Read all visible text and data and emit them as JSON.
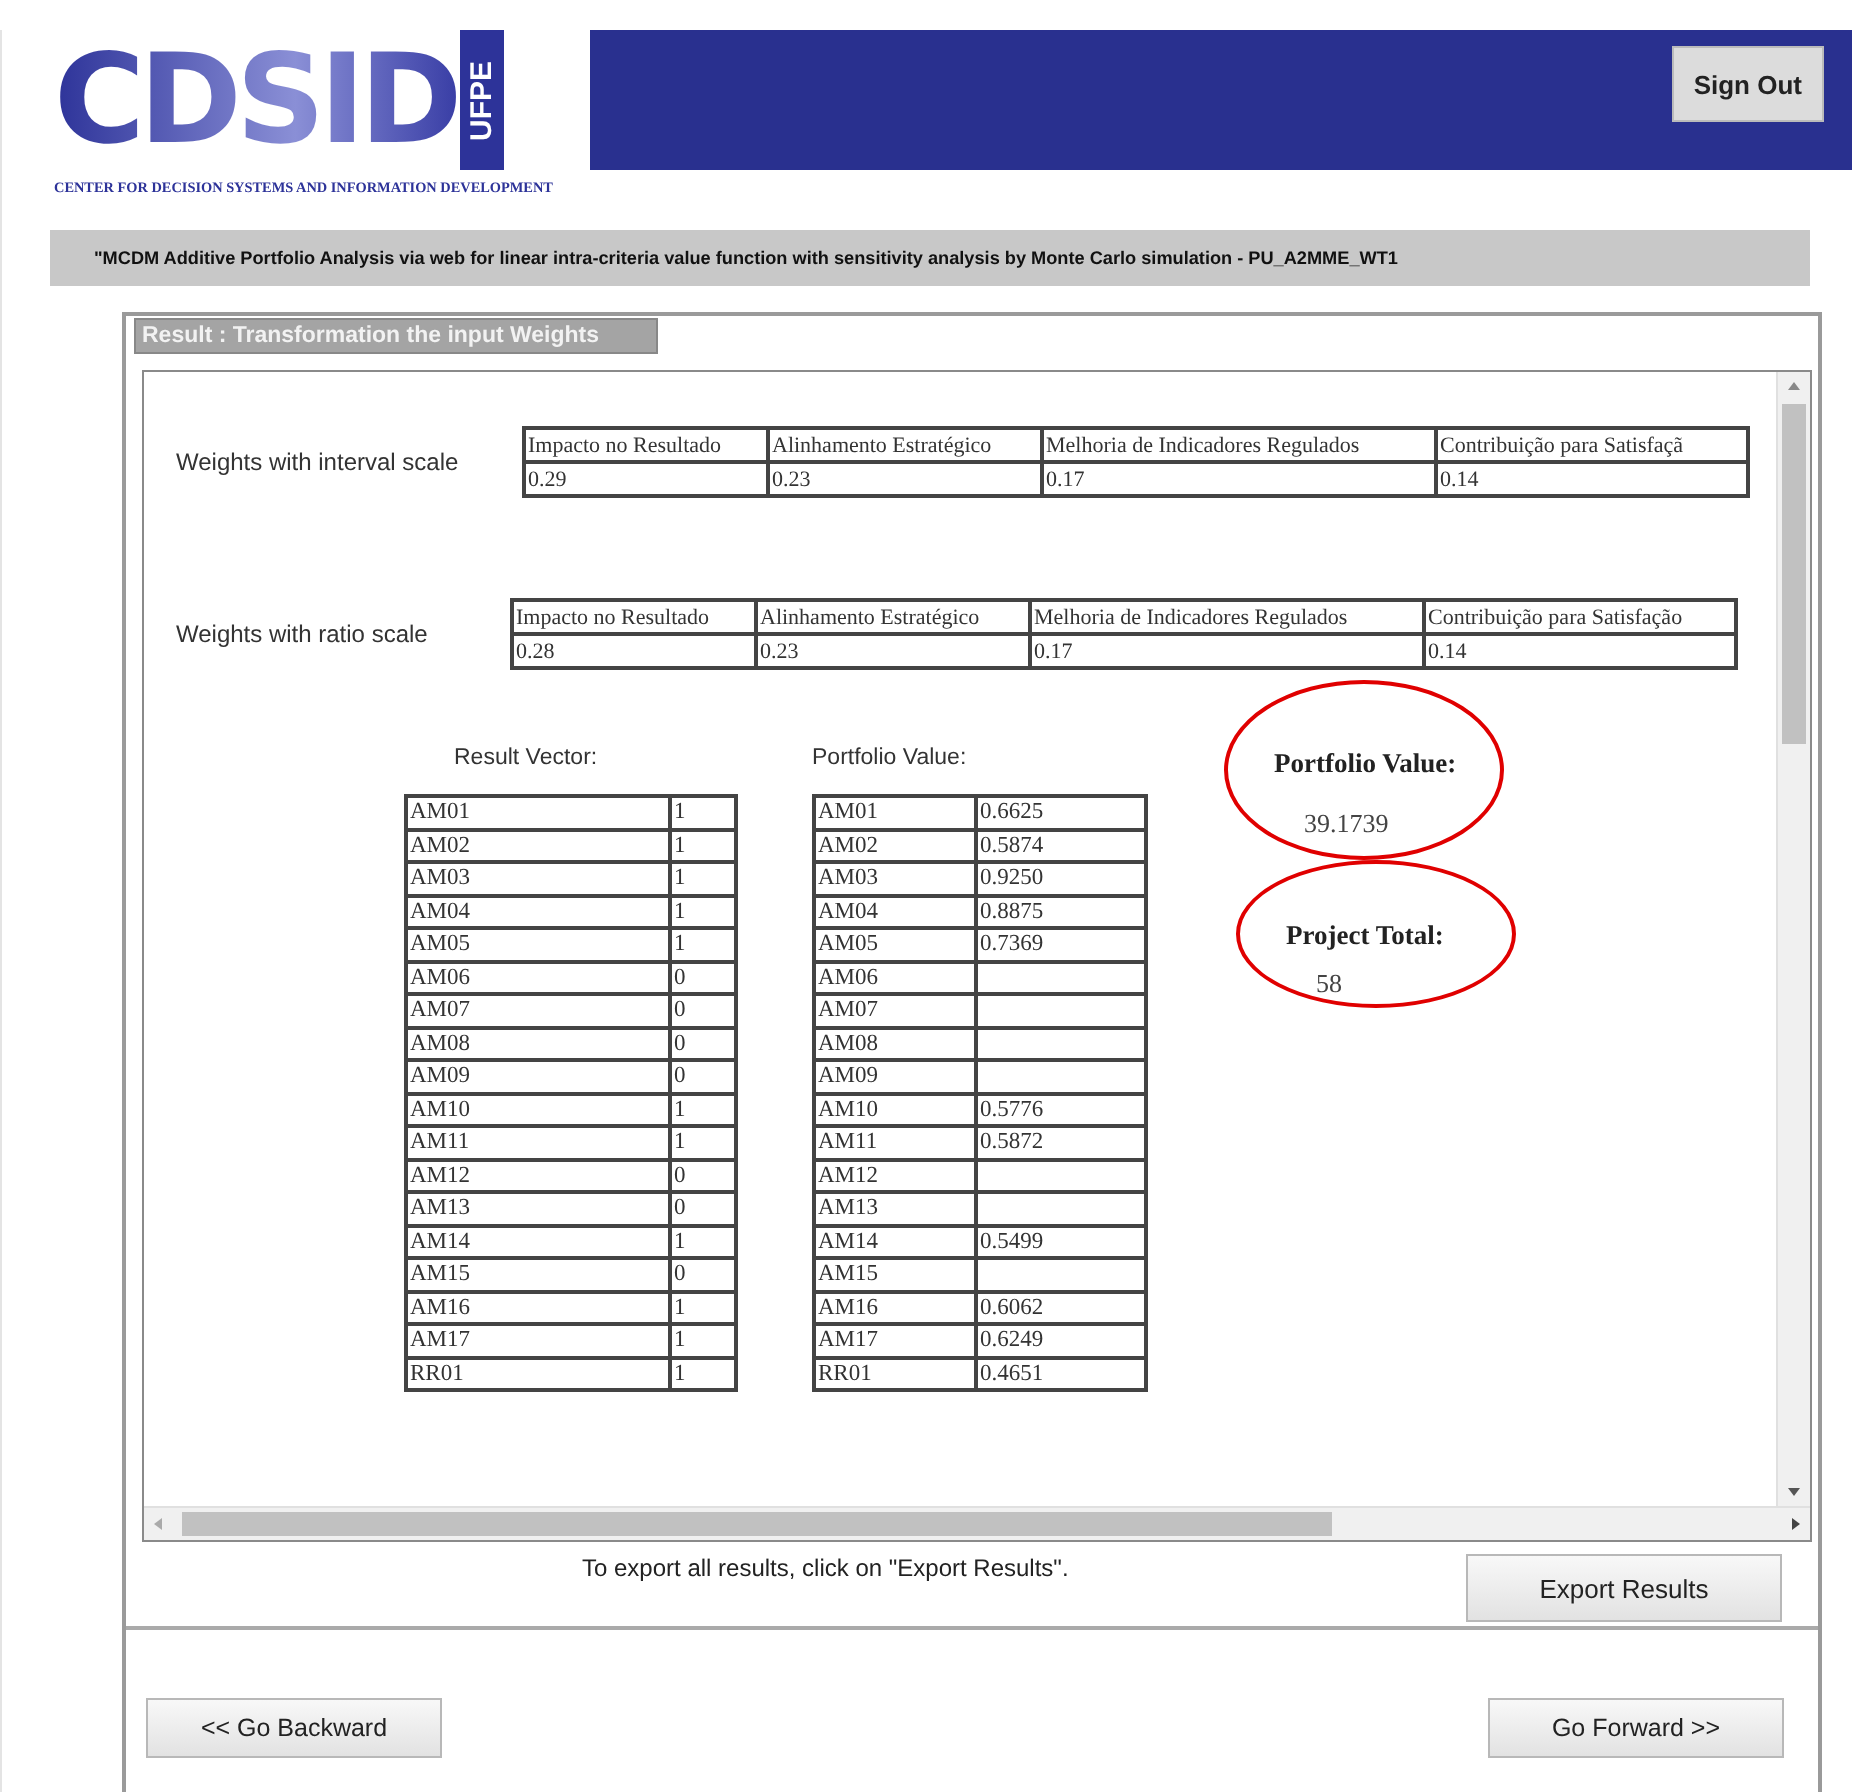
{
  "header": {
    "logo": "CDSID",
    "logo_side": "UFPE",
    "logo_caption": "CENTER FOR DECISION SYSTEMS AND INFORMATION DEVELOPMENT",
    "sign_out": "Sign Out"
  },
  "subtitle": "\"MCDM Additive Portfolio Analysis via web for linear intra-criteria value function with sensitivity analysis by Monte Carlo simulation - PU_A2MME_WT1",
  "panel": {
    "title": "Result : Transformation the input Weights",
    "weights": [
      {
        "label": "Weights with interval scale",
        "columns": [
          "Impacto no Resultado",
          "Alinhamento Estratégico",
          "Melhoria de Indicadores Regulados",
          "Contribuição para Satisfaçã"
        ],
        "values": [
          "0.29",
          "0.23",
          "0.17",
          "0.14"
        ]
      },
      {
        "label": "Weights with ratio scale",
        "columns": [
          "Impacto no Resultado",
          "Alinhamento Estratégico",
          "Melhoria de Indicadores Regulados",
          "Contribuição para Satisfação"
        ],
        "values": [
          "0.28",
          "0.23",
          "0.17",
          "0.14"
        ]
      }
    ],
    "result_vector": {
      "label": "Result Vector:",
      "rows": [
        {
          "name": "AM01",
          "value": "1"
        },
        {
          "name": "AM02",
          "value": "1"
        },
        {
          "name": "AM03",
          "value": "1"
        },
        {
          "name": "AM04",
          "value": "1"
        },
        {
          "name": "AM05",
          "value": "1"
        },
        {
          "name": "AM06",
          "value": "0"
        },
        {
          "name": "AM07",
          "value": "0"
        },
        {
          "name": "AM08",
          "value": "0"
        },
        {
          "name": "AM09",
          "value": "0"
        },
        {
          "name": "AM10",
          "value": "1"
        },
        {
          "name": "AM11",
          "value": "1"
        },
        {
          "name": "AM12",
          "value": "0"
        },
        {
          "name": "AM13",
          "value": "0"
        },
        {
          "name": "AM14",
          "value": "1"
        },
        {
          "name": "AM15",
          "value": "0"
        },
        {
          "name": "AM16",
          "value": "1"
        },
        {
          "name": "AM17",
          "value": "1"
        },
        {
          "name": "RR01",
          "value": "1"
        }
      ]
    },
    "portfolio_table": {
      "label": "Portfolio Value:",
      "rows": [
        {
          "name": "AM01",
          "value": "0.6625"
        },
        {
          "name": "AM02",
          "value": "0.5874"
        },
        {
          "name": "AM03",
          "value": "0.9250"
        },
        {
          "name": "AM04",
          "value": "0.8875"
        },
        {
          "name": "AM05",
          "value": "0.7369"
        },
        {
          "name": "AM06"
        },
        {
          "name": "AM07"
        },
        {
          "name": "AM08"
        },
        {
          "name": "AM09"
        },
        {
          "name": "AM10",
          "value": "0.5776"
        },
        {
          "name": "AM11",
          "value": "0.5872"
        },
        {
          "name": "AM12"
        },
        {
          "name": "AM13"
        },
        {
          "name": "AM14",
          "value": "0.5499"
        },
        {
          "name": "AM15"
        },
        {
          "name": "AM16",
          "value": "0.6062"
        },
        {
          "name": "AM17",
          "value": "0.6249"
        },
        {
          "name": "RR01",
          "value": "0.4651"
        }
      ]
    },
    "summary": [
      {
        "label": "Portfolio Value:",
        "value": "39.1739",
        "highlighted": true
      },
      {
        "label": "Project Total:",
        "value": "58",
        "highlighted": true
      }
    ],
    "export_hint": "To export all results, click on \"Export Results\".",
    "export_button": "Export Results"
  },
  "navigation": {
    "back": "<< Go Backward",
    "forward": "Go Forward >>"
  }
}
